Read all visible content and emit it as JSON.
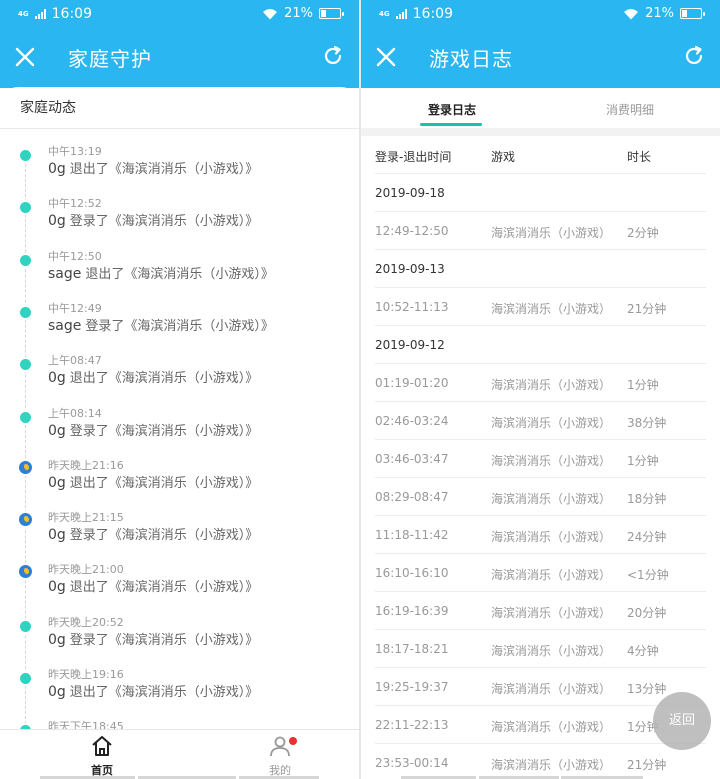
{
  "status_bar": {
    "network": "4G",
    "time": "16:09",
    "battery": "21%"
  },
  "left": {
    "title": "家庭守护",
    "section_title": "家庭动态",
    "events": [
      {
        "time": "中午13:19",
        "user": "0g",
        "action": "退出了《海滨消消乐（小游戏）》",
        "icon": "sun"
      },
      {
        "time": "中午12:52",
        "user": "0g",
        "action": "登录了《海滨消消乐（小游戏）》",
        "icon": "sun"
      },
      {
        "time": "中午12:50",
        "user": "sage",
        "action": "退出了《海滨消消乐（小游戏）》",
        "icon": "sun"
      },
      {
        "time": "中午12:49",
        "user": "sage",
        "action": "登录了《海滨消消乐（小游戏）》",
        "icon": "sun"
      },
      {
        "time": "上午08:47",
        "user": "0g",
        "action": "退出了《海滨消消乐（小游戏）》",
        "icon": "sun"
      },
      {
        "time": "上午08:14",
        "user": "0g",
        "action": "登录了《海滨消消乐（小游戏）》",
        "icon": "sun"
      },
      {
        "time": "昨天晚上21:16",
        "user": "0g",
        "action": "退出了《海滨消消乐（小游戏）》",
        "icon": "moon"
      },
      {
        "time": "昨天晚上21:15",
        "user": "0g",
        "action": "登录了《海滨消消乐（小游戏）》",
        "icon": "moon"
      },
      {
        "time": "昨天晚上21:00",
        "user": "0g",
        "action": "退出了《海滨消消乐（小游戏）》",
        "icon": "moon"
      },
      {
        "time": "昨天晚上20:52",
        "user": "0g",
        "action": "登录了《海滨消消乐（小游戏）》",
        "icon": "sun"
      },
      {
        "time": "昨天晚上19:16",
        "user": "0g",
        "action": "退出了《海滨消消乐（小游戏）》",
        "icon": "sun"
      },
      {
        "time": "昨天下午18:45",
        "user": "",
        "action": "",
        "icon": "sun"
      }
    ],
    "nav": {
      "home": "首页",
      "mine": "我的"
    }
  },
  "right": {
    "title": "游戏日志",
    "tabs": {
      "login": "登录日志",
      "consume": "消费明细"
    },
    "columns": {
      "time": "登录-退出时间",
      "game": "游戏",
      "duration": "时长"
    },
    "log": [
      {
        "date": "2019-09-18",
        "rows": [
          {
            "time": "12:49-12:50",
            "game": "海滨消消乐（小游戏）",
            "duration": "2分钟"
          }
        ]
      },
      {
        "date": "2019-09-13",
        "rows": [
          {
            "time": "10:52-11:13",
            "game": "海滨消消乐（小游戏）",
            "duration": "21分钟"
          }
        ]
      },
      {
        "date": "2019-09-12",
        "rows": [
          {
            "time": "01:19-01:20",
            "game": "海滨消消乐（小游戏）",
            "duration": "1分钟"
          },
          {
            "time": "02:46-03:24",
            "game": "海滨消消乐（小游戏）",
            "duration": "38分钟"
          },
          {
            "time": "03:46-03:47",
            "game": "海滨消消乐（小游戏）",
            "duration": "1分钟"
          },
          {
            "time": "08:29-08:47",
            "game": "海滨消消乐（小游戏）",
            "duration": "18分钟"
          },
          {
            "time": "11:18-11:42",
            "game": "海滨消消乐（小游戏）",
            "duration": "24分钟"
          },
          {
            "time": "16:10-16:10",
            "game": "海滨消消乐（小游戏）",
            "duration": "<1分钟"
          },
          {
            "time": "16:19-16:39",
            "game": "海滨消消乐（小游戏）",
            "duration": "20分钟"
          },
          {
            "time": "18:17-18:21",
            "game": "海滨消消乐（小游戏）",
            "duration": "4分钟"
          },
          {
            "time": "19:25-19:37",
            "game": "海滨消消乐（小游戏）",
            "duration": "13分钟"
          },
          {
            "time": "22:11-22:13",
            "game": "海滨消消乐（小游戏）",
            "duration": "1分钟"
          },
          {
            "time": "23:53-00:14",
            "game": "海滨消消乐（小游戏）",
            "duration": "21分钟"
          }
        ]
      }
    ],
    "back_label": "返回"
  },
  "colors": {
    "header": "#2ab6f0",
    "tab_accent": "#1bc1b0",
    "badge": "#e8302c"
  }
}
